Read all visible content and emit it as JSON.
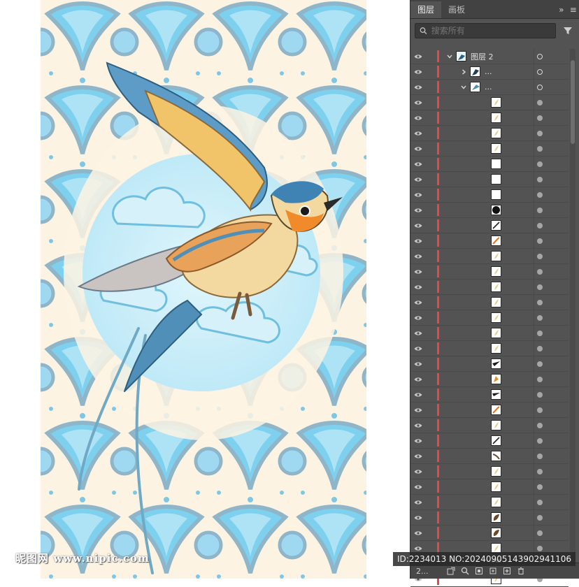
{
  "panel": {
    "tabs": [
      {
        "label": "图层",
        "active": true
      },
      {
        "label": "画板",
        "active": false
      }
    ],
    "search_placeholder": "搜索所有",
    "top_layer_name": "图层 2",
    "group_name_1": "...",
    "group_name_2": "...",
    "layer_count_label": "2..."
  },
  "colors": {
    "layer_color": "#e24a4a",
    "panel_bg": "#535353",
    "artboard_sky": "#cfeef8"
  },
  "icons": [
    "eye-icon",
    "search-icon",
    "filter-icon",
    "chevron-right-icon",
    "chevron-down-icon",
    "panel-menu-icon"
  ],
  "sublayer_thumbs": [
    "feather",
    "feather",
    "feather",
    "feather",
    "blank",
    "blank",
    "blank",
    "dark-circle",
    "dark-stroke",
    "orange-stroke",
    "feather",
    "feather",
    "feather",
    "feather",
    "feather",
    "feather",
    "feather",
    "beak",
    "orange-feather",
    "dark-beak",
    "orange-stroke",
    "feather",
    "dark-stroke",
    "brown-stroke",
    "feather",
    "feather",
    "feather",
    "brown-leaf",
    "brown-leaf",
    "feather",
    "brown-stroke",
    "feather"
  ],
  "watermark": {
    "left": "昵图网 www.nipic.com",
    "right": "ID:2234013 NO:20240905143902941106"
  }
}
